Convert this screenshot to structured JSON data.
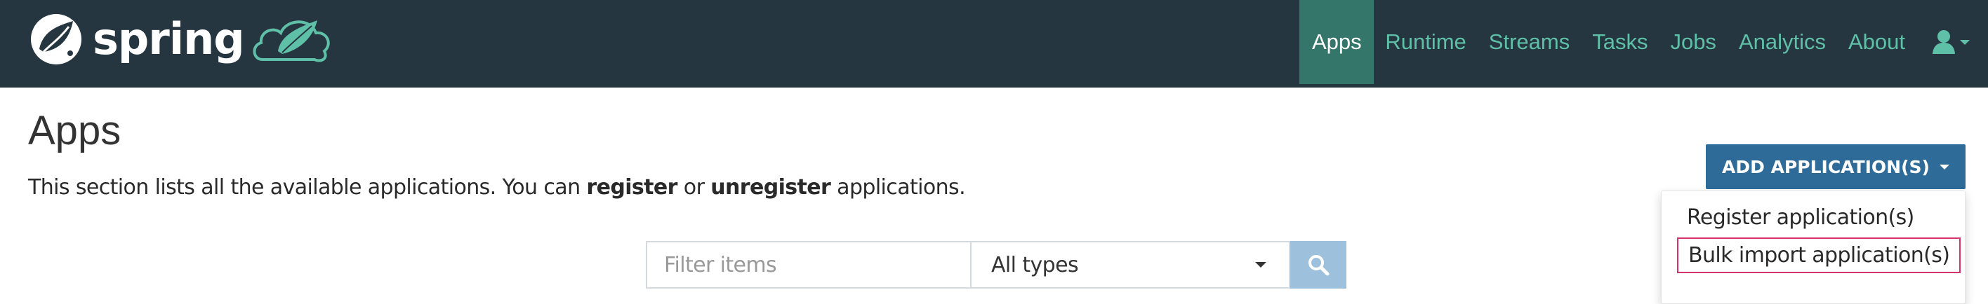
{
  "brand": {
    "name": "spring"
  },
  "nav": {
    "items": [
      {
        "label": "Apps",
        "active": true
      },
      {
        "label": "Runtime"
      },
      {
        "label": "Streams"
      },
      {
        "label": "Tasks"
      },
      {
        "label": "Jobs"
      },
      {
        "label": "Analytics"
      },
      {
        "label": "About"
      }
    ],
    "user_icon": "user-icon"
  },
  "page": {
    "title": "Apps",
    "description_prefix": "This section lists all the available applications. You can ",
    "description_register": "register",
    "description_or": " or ",
    "description_unregister": "unregister",
    "description_suffix": " applications."
  },
  "filter": {
    "placeholder": "Filter items",
    "type_value": "All types",
    "search_icon": "search-icon"
  },
  "add_application": {
    "label": "ADD APPLICATION(S)",
    "menu": [
      {
        "label": "Register application(s)"
      },
      {
        "label": "Bulk import application(s)",
        "highlighted": true
      }
    ]
  },
  "colors": {
    "navbar_bg": "#263640",
    "nav_link": "#5fc0a8",
    "nav_active_bg": "#34776a",
    "primary_button": "#2e6b99",
    "search_button": "#9dc0dc",
    "highlight_border": "#d6336c"
  }
}
